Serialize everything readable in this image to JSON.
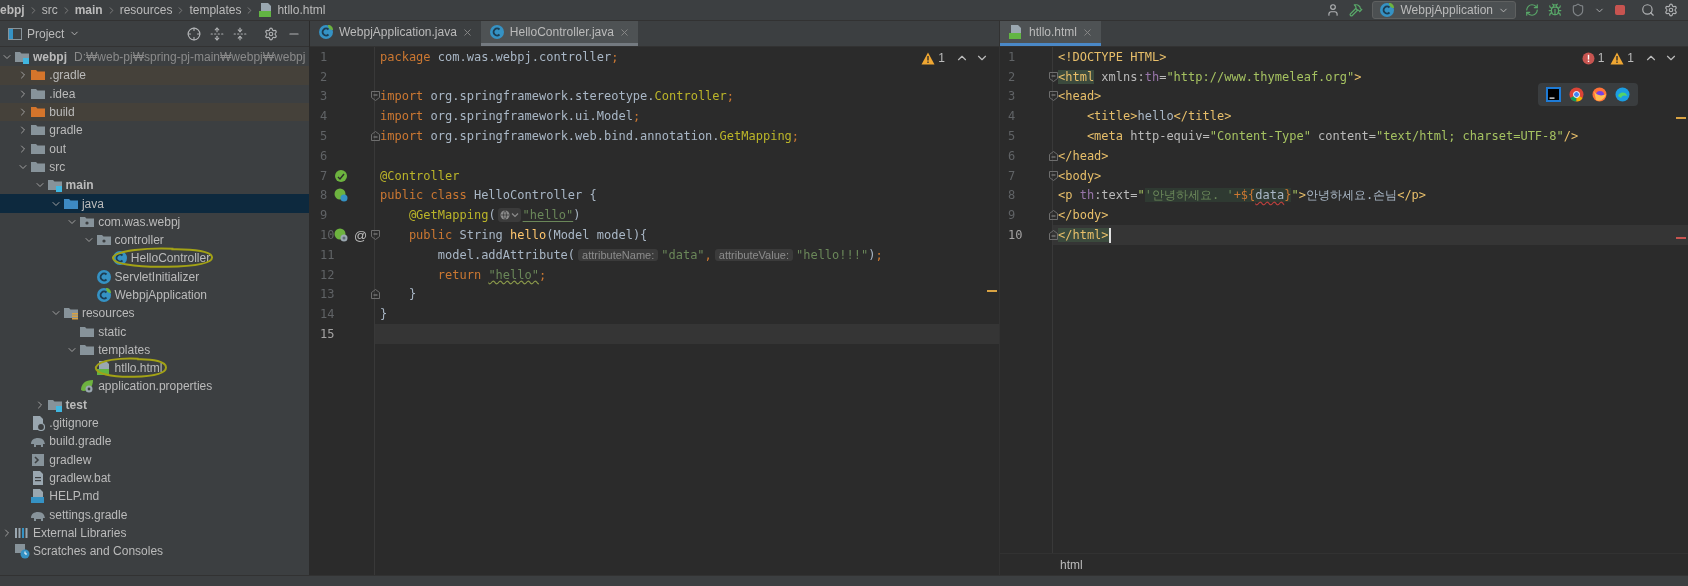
{
  "breadcrumbs": [
    {
      "label": "ebpj",
      "bold": true
    },
    {
      "label": "src",
      "bold": false
    },
    {
      "label": "main",
      "bold": true
    },
    {
      "label": "resources",
      "bold": false
    },
    {
      "label": "templates",
      "bold": false
    },
    {
      "label": "htllo.html",
      "bold": false,
      "kind": "html-file"
    }
  ],
  "toolbar": {
    "run_configuration": "WebpjApplication"
  },
  "project_panel": {
    "title": "Project",
    "tree": [
      {
        "label": "webpj",
        "kind": "module",
        "bold": true,
        "path": "D:₩web-pj₩spring-pj-main₩webpj₩webpj",
        "expanded": true,
        "selected": false,
        "children": [
          {
            "label": ".gradle",
            "kind": "excluded-folder",
            "expanded": false,
            "selected": false
          },
          {
            "label": ".idea",
            "kind": "folder",
            "expanded": false,
            "selected": false
          },
          {
            "label": "build",
            "kind": "excluded-folder",
            "expanded": false,
            "selected": false
          },
          {
            "label": "gradle",
            "kind": "folder",
            "expanded": false,
            "selected": false
          },
          {
            "label": "out",
            "kind": "folder",
            "expanded": false,
            "selected": false
          },
          {
            "label": "src",
            "kind": "folder",
            "expanded": true,
            "selected": false,
            "children": [
              {
                "label": "main",
                "kind": "module",
                "bold": true,
                "expanded": true,
                "selected": false,
                "children": [
                  {
                    "label": "java",
                    "kind": "source-root",
                    "expanded": true,
                    "selected": true,
                    "children": [
                      {
                        "label": "com.was.webpj",
                        "kind": "package",
                        "expanded": true,
                        "selected": false,
                        "children": [
                          {
                            "label": "controller",
                            "kind": "package",
                            "expanded": true,
                            "selected": false,
                            "children": [
                              {
                                "label": "HelloController",
                                "kind": "class",
                                "selected": false,
                                "circled": true
                              }
                            ]
                          },
                          {
                            "label": "ServletInitializer",
                            "kind": "class",
                            "selected": false
                          },
                          {
                            "label": "WebpjApplication",
                            "kind": "spring-app",
                            "selected": false
                          }
                        ]
                      }
                    ]
                  },
                  {
                    "label": "resources",
                    "kind": "resources-root",
                    "expanded": true,
                    "selected": false,
                    "children": [
                      {
                        "label": "static",
                        "kind": "folder",
                        "selected": false
                      },
                      {
                        "label": "templates",
                        "kind": "folder",
                        "expanded": true,
                        "selected": false,
                        "children": [
                          {
                            "label": "htllo.html",
                            "kind": "html-file",
                            "selected": false,
                            "circled": true
                          }
                        ]
                      },
                      {
                        "label": "application.properties",
                        "kind": "properties",
                        "selected": false
                      }
                    ]
                  }
                ]
              },
              {
                "label": "test",
                "kind": "module",
                "bold": true,
                "expanded": false,
                "selected": false
              }
            ]
          },
          {
            "label": ".gitignore",
            "kind": "gitignore",
            "selected": false
          },
          {
            "label": "build.gradle",
            "kind": "gradle",
            "selected": false
          },
          {
            "label": "gradlew",
            "kind": "script",
            "selected": false
          },
          {
            "label": "gradlew.bat",
            "kind": "bat",
            "selected": false
          },
          {
            "label": "HELP.md",
            "kind": "markdown",
            "selected": false
          },
          {
            "label": "settings.gradle",
            "kind": "gradle",
            "selected": false
          }
        ]
      },
      {
        "label": "External Libraries",
        "kind": "libraries",
        "expanded": false,
        "selected": false
      },
      {
        "label": "Scratches and Consoles",
        "kind": "scratches",
        "selected": false
      }
    ]
  },
  "editors": [
    {
      "focused": false,
      "tabs": [
        {
          "label": "WebpjApplication.java",
          "kind": "spring-app",
          "selected": false
        },
        {
          "label": "HelloController.java",
          "kind": "class",
          "selected": true
        }
      ],
      "inspections": [
        {
          "kind": "warning",
          "count": "1"
        }
      ],
      "lines": [
        {
          "number": "1",
          "tokens": [
            {
              "text": "package",
              "kind": "kw"
            },
            {
              "text": " com.was.webpj.controller",
              "kind": "plain"
            },
            {
              "text": ";",
              "kind": "kw"
            }
          ]
        },
        {
          "number": "2"
        },
        {
          "number": "3",
          "fold_open": true,
          "tokens": [
            {
              "text": "import",
              "kind": "kw"
            },
            {
              "text": " org.springframework.stereotype.",
              "kind": "plain"
            },
            {
              "text": "Controller",
              "kind": "ann"
            },
            {
              "text": ";",
              "kind": "kw"
            }
          ]
        },
        {
          "number": "4",
          "tokens": [
            {
              "text": "import",
              "kind": "kw"
            },
            {
              "text": " org.springframework.ui.Model",
              "kind": "plain"
            },
            {
              "text": ";",
              "kind": "kw"
            }
          ]
        },
        {
          "number": "5",
          "fold_close": true,
          "tokens": [
            {
              "text": "import",
              "kind": "kw"
            },
            {
              "text": " org.springframework.web.bind.annotation.",
              "kind": "plain"
            },
            {
              "text": "GetMapping",
              "kind": "ann"
            },
            {
              "text": ";",
              "kind": "kw"
            }
          ]
        },
        {
          "number": "6"
        },
        {
          "number": "7",
          "gutter": [
            {
              "kind": "bean"
            }
          ],
          "tokens": [
            {
              "text": "@Controller",
              "kind": "ann"
            }
          ]
        },
        {
          "number": "8",
          "gutter": [
            {
              "kind": "bean-class"
            }
          ],
          "tokens": [
            {
              "text": "public class ",
              "kind": "kw"
            },
            {
              "text": "HelloController {",
              "kind": "plain"
            }
          ]
        },
        {
          "number": "9",
          "tokens": [
            {
              "text": "    @GetMapping",
              "kind": "ann"
            },
            {
              "text": "(",
              "kind": "plain"
            },
            {
              "kind": "inlay-web"
            },
            {
              "text": "\"hello\"",
              "kind": "str",
              "link": true
            },
            {
              "text": ")",
              "kind": "plain"
            }
          ]
        },
        {
          "number": "10",
          "fold_open": true,
          "gutter": [
            {
              "kind": "endpoint"
            },
            {
              "kind": "text",
              "text": "@"
            }
          ],
          "tokens": [
            {
              "text": "    public ",
              "kind": "kw"
            },
            {
              "text": "String ",
              "kind": "plain"
            },
            {
              "text": "hello",
              "kind": "decl"
            },
            {
              "text": "(Model model){",
              "kind": "plain"
            }
          ]
        },
        {
          "number": "11",
          "tokens": [
            {
              "text": "        model.addAttribute(",
              "kind": "plain"
            },
            {
              "text": "attributeName:",
              "kind": "hint"
            },
            {
              "text": "\"data\"",
              "kind": "str"
            },
            {
              "text": ",",
              "kind": "kw"
            },
            {
              "text": "attributeValue:",
              "kind": "hint"
            },
            {
              "text": "\"hello!!!\"",
              "kind": "str"
            },
            {
              "text": ")",
              "kind": "plain"
            },
            {
              "text": ";",
              "kind": "kw"
            }
          ]
        },
        {
          "number": "12",
          "tokens": [
            {
              "text": "        return ",
              "kind": "kw"
            },
            {
              "text": "\"hello\"",
              "kind": "str",
              "typo": true
            },
            {
              "text": ";",
              "kind": "kw"
            }
          ]
        },
        {
          "number": "13",
          "fold_close": true,
          "tokens": [
            {
              "text": "    }",
              "kind": "plain"
            }
          ]
        },
        {
          "number": "14",
          "tokens": [
            {
              "text": "}",
              "kind": "plain"
            }
          ]
        },
        {
          "number": "15",
          "current": true
        }
      ]
    },
    {
      "focused": true,
      "tabs": [
        {
          "label": "htllo.html",
          "kind": "html-file",
          "selected": true
        }
      ],
      "inspections": [
        {
          "kind": "error",
          "count": "1"
        },
        {
          "kind": "warning",
          "count": "1"
        }
      ],
      "browser_popup": true,
      "lines": [
        {
          "number": "1",
          "tokens": [
            {
              "text": "<!DOCTYPE HTML>",
              "kind": "tag"
            }
          ]
        },
        {
          "number": "2",
          "fold_open": true,
          "tokens": [
            {
              "text": "<html",
              "kind": "tag-match"
            },
            {
              "text": " xmlns:",
              "kind": "attr"
            },
            {
              "text": "th",
              "kind": "ns"
            },
            {
              "text": "=",
              "kind": "attr"
            },
            {
              "text": "\"http://www.thymeleaf.org\"",
              "kind": "val"
            },
            {
              "text": ">",
              "kind": "tag"
            }
          ]
        },
        {
          "number": "3",
          "fold_open": true,
          "tokens": [
            {
              "text": "<head>",
              "kind": "tag"
            }
          ]
        },
        {
          "number": "4",
          "tokens": [
            {
              "text": "    <title>",
              "kind": "tag"
            },
            {
              "text": "hello",
              "kind": "plain"
            },
            {
              "text": "</title>",
              "kind": "tag"
            }
          ]
        },
        {
          "number": "5",
          "tokens": [
            {
              "text": "    <meta",
              "kind": "tag"
            },
            {
              "text": " http-equiv=",
              "kind": "attr"
            },
            {
              "text": "\"Content-Type\"",
              "kind": "val"
            },
            {
              "text": " content=",
              "kind": "attr"
            },
            {
              "text": "\"text/html; charset=UTF-8\"",
              "kind": "val"
            },
            {
              "text": "/>",
              "kind": "tag"
            }
          ]
        },
        {
          "number": "6",
          "fold_close": true,
          "tokens": [
            {
              "text": "</head>",
              "kind": "tag"
            }
          ]
        },
        {
          "number": "7",
          "fold_open": true,
          "tokens": [
            {
              "text": "<body>",
              "kind": "tag"
            }
          ]
        },
        {
          "number": "8",
          "tokens": [
            {
              "text": "<p ",
              "kind": "tag"
            },
            {
              "text": "th",
              "kind": "ns"
            },
            {
              "text": ":text=",
              "kind": "attr"
            },
            {
              "text": "\"",
              "kind": "val"
            },
            {
              "text": "'안녕하세요. '",
              "kind": "inj-str"
            },
            {
              "text": "+${",
              "kind": "inj-op"
            },
            {
              "text": "data",
              "kind": "inj-var",
              "error": true
            },
            {
              "text": "}",
              "kind": "inj-op"
            },
            {
              "text": "\"",
              "kind": "val"
            },
            {
              "text": ">",
              "kind": "tag"
            },
            {
              "text": "안녕하세요.손님",
              "kind": "plain"
            },
            {
              "text": "</p>",
              "kind": "tag"
            }
          ]
        },
        {
          "number": "9",
          "fold_close": true,
          "tokens": [
            {
              "text": "</body>",
              "kind": "tag"
            }
          ]
        },
        {
          "number": "10",
          "fold_close": true,
          "current": true,
          "cursor": true,
          "tokens": [
            {
              "text": "</html>",
              "kind": "tag-match"
            }
          ]
        }
      ],
      "status_breadcrumbs": [
        "html"
      ]
    }
  ]
}
